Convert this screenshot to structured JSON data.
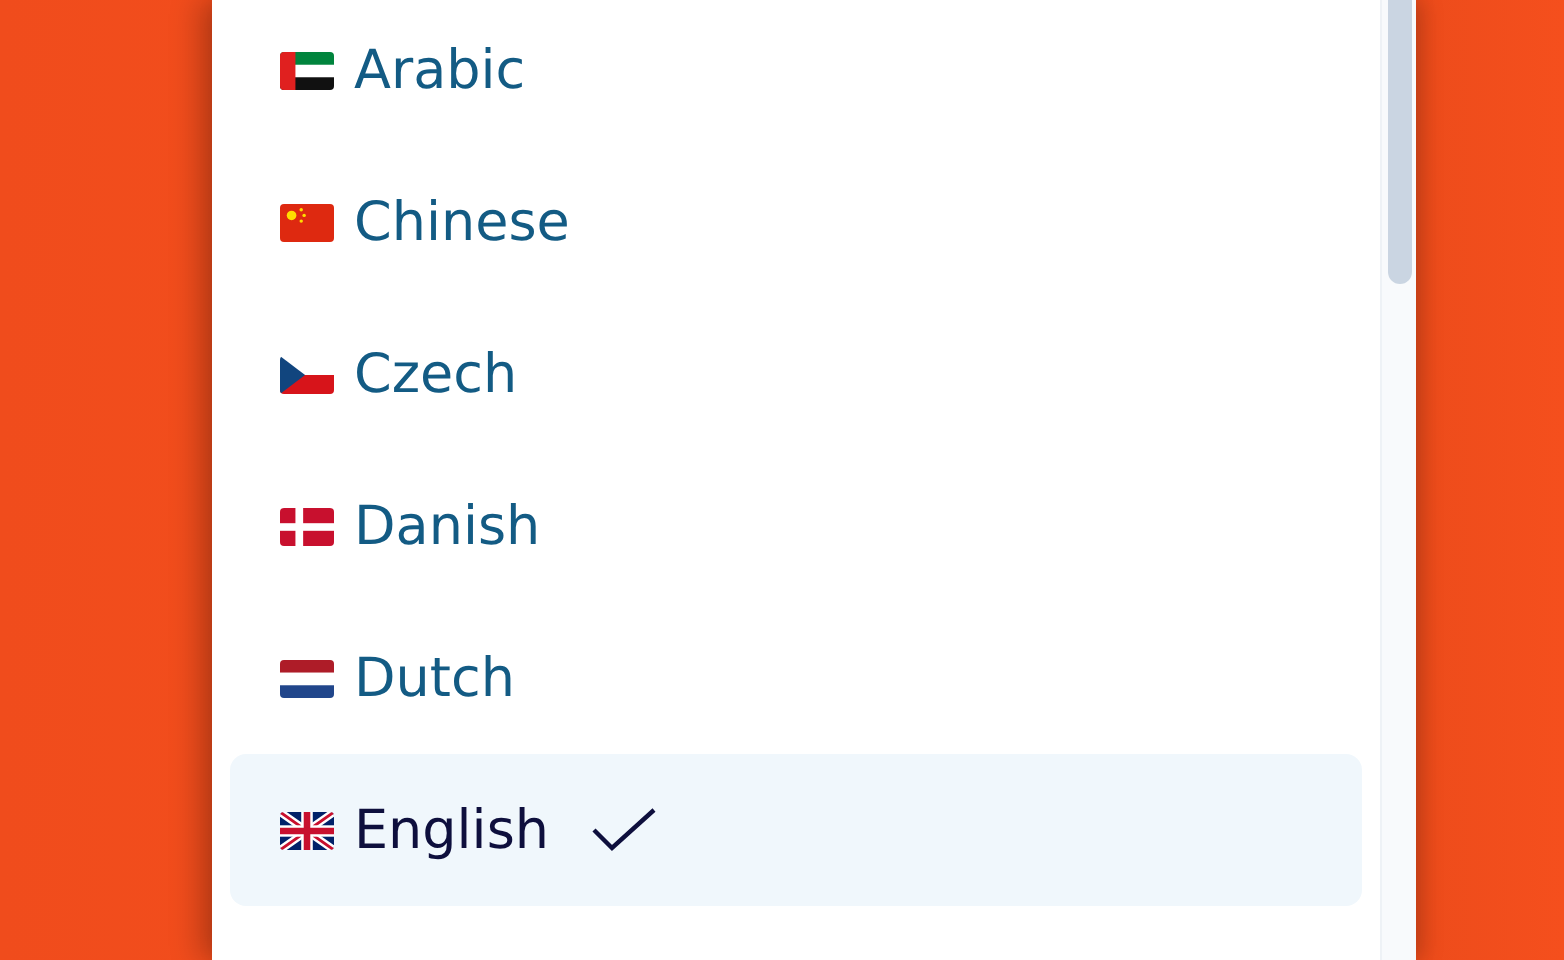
{
  "language_menu": {
    "options": [
      {
        "label": "Arabic",
        "selected": false
      },
      {
        "label": "Chinese",
        "selected": false
      },
      {
        "label": "Czech",
        "selected": false
      },
      {
        "label": "Danish",
        "selected": false
      },
      {
        "label": "Dutch",
        "selected": false
      },
      {
        "label": "English",
        "selected": true
      }
    ]
  }
}
